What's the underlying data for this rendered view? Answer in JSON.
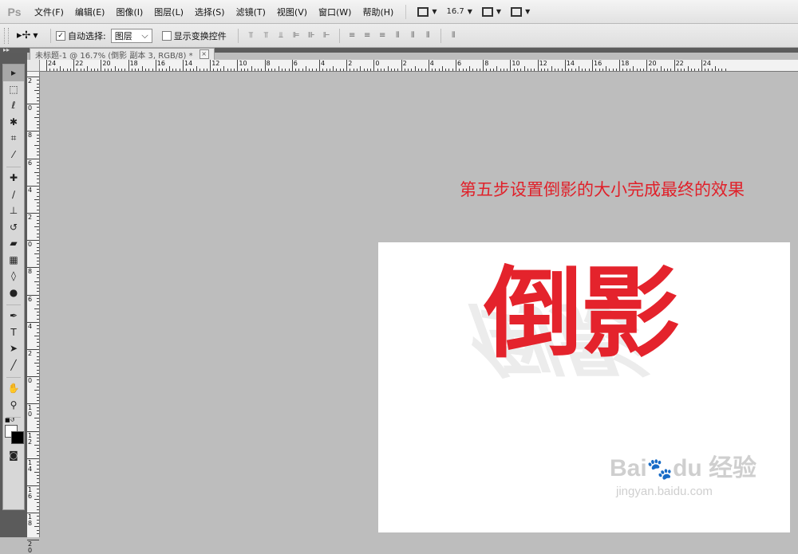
{
  "app": {
    "logo": "Ps"
  },
  "menu": [
    "文件(F)",
    "编辑(E)",
    "图像(I)",
    "图层(L)",
    "选择(S)",
    "滤镜(T)",
    "视图(V)",
    "窗口(W)",
    "帮助(H)"
  ],
  "menubar_controls": {
    "zoom": "16.7"
  },
  "options": {
    "auto_select_label": "自动选择:",
    "auto_select_checked": true,
    "auto_select_target": "图层",
    "transform_controls_label": "显示变换控件",
    "transform_controls_checked": false
  },
  "document": {
    "tab_title": "未标题-1 @ 16.7% (倒影 副本 3, RGB/8) *",
    "close_glyph": "×"
  },
  "rulers": {
    "horizontal_labels": [
      "24",
      "22",
      "20",
      "18",
      "16",
      "14",
      "12",
      "10",
      "8",
      "6",
      "4",
      "2",
      "0",
      "2",
      "4",
      "6",
      "8",
      "10",
      "12",
      "14",
      "16",
      "18",
      "20",
      "22",
      "24"
    ],
    "vertical_labels": [
      "2",
      "0",
      "8",
      "6",
      "4",
      "2",
      "0",
      "8",
      "6",
      "4",
      "2",
      "0",
      "1 0",
      "1 2",
      "1 4",
      "1 6",
      "1 8",
      "2 0"
    ]
  },
  "canvas": {
    "caption": "第五步设置倒影的大小完成最终的效果",
    "main_text": "倒影",
    "reflection_text": "倒影",
    "accent_color": "#e4232c"
  },
  "watermark": {
    "brand": "Bai",
    "paw": "🐾",
    "brand2": "du",
    "product": "经验",
    "url": "jingyan.baidu.com"
  },
  "tools": [
    "move-tool-icon",
    "marquee-tool-icon",
    "lasso-tool-icon",
    "quick-select-tool-icon",
    "crop-tool-icon",
    "eyedropper-tool-icon",
    "healing-brush-tool-icon",
    "brush-tool-icon",
    "clone-stamp-tool-icon",
    "history-brush-tool-icon",
    "eraser-tool-icon",
    "gradient-tool-icon",
    "blur-tool-icon",
    "dodge-tool-icon",
    "pen-tool-icon",
    "type-tool-icon",
    "path-select-tool-icon",
    "line-tool-icon",
    "hand-tool-icon",
    "zoom-tool-icon"
  ]
}
